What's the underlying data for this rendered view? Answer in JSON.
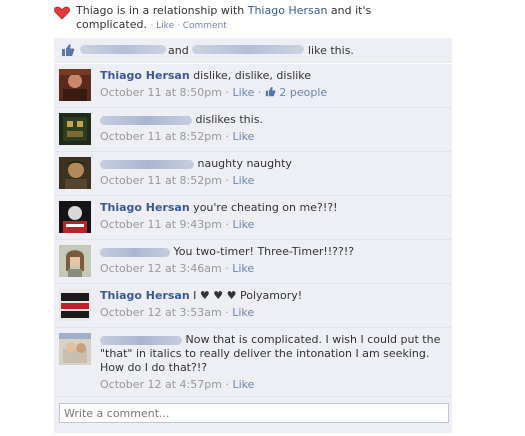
{
  "story": {
    "text_prefix": "Thiago is in a relationship with ",
    "partner": "Thiago Hersan",
    "text_suffix": " and it's complicated.",
    "action_like": "Like",
    "action_comment": "Comment",
    "sep": " · "
  },
  "likes": {
    "and": "and",
    "suffix": "like this."
  },
  "comments": [
    {
      "name": "Thiago Hersan",
      "text": " dislike, dislike, dislike",
      "time": "October 11 at 8:50pm",
      "like": "Like",
      "likes_count": "2 people"
    },
    {
      "text": "dislikes this.",
      "time": "October 11 at 8:52pm",
      "like": "Like"
    },
    {
      "text": "naughty naughty",
      "time": "October 11 at 8:52pm",
      "like": "Like"
    },
    {
      "name": "Thiago Hersan",
      "text": " you're cheating on me?!?!",
      "time": "October 11 at 9:43pm",
      "like": "Like"
    },
    {
      "text": "You two-timer! Three-Timer!!??!?",
      "time": "October 12 at 3:46am",
      "like": "Like"
    },
    {
      "name": "Thiago Hersan",
      "text": " I ♥ ♥ ♥ Polyamory!",
      "time": "October 12 at 3:53am",
      "like": "Like"
    },
    {
      "text": "Now that is complicated. I wish I could put the \"that\" in italics to really deliver the intonation I am seeking. How do I do that?!?",
      "time": "October 12 at 4:57pm",
      "like": "Like"
    }
  ],
  "write_comment": {
    "placeholder": "Write a comment..."
  },
  "colors": {
    "link": "#3b5998",
    "panel_bg": "#edeff4",
    "heart": "#e0393e"
  },
  "icons": [
    "heart-icon",
    "thumbs-up-icon"
  ]
}
